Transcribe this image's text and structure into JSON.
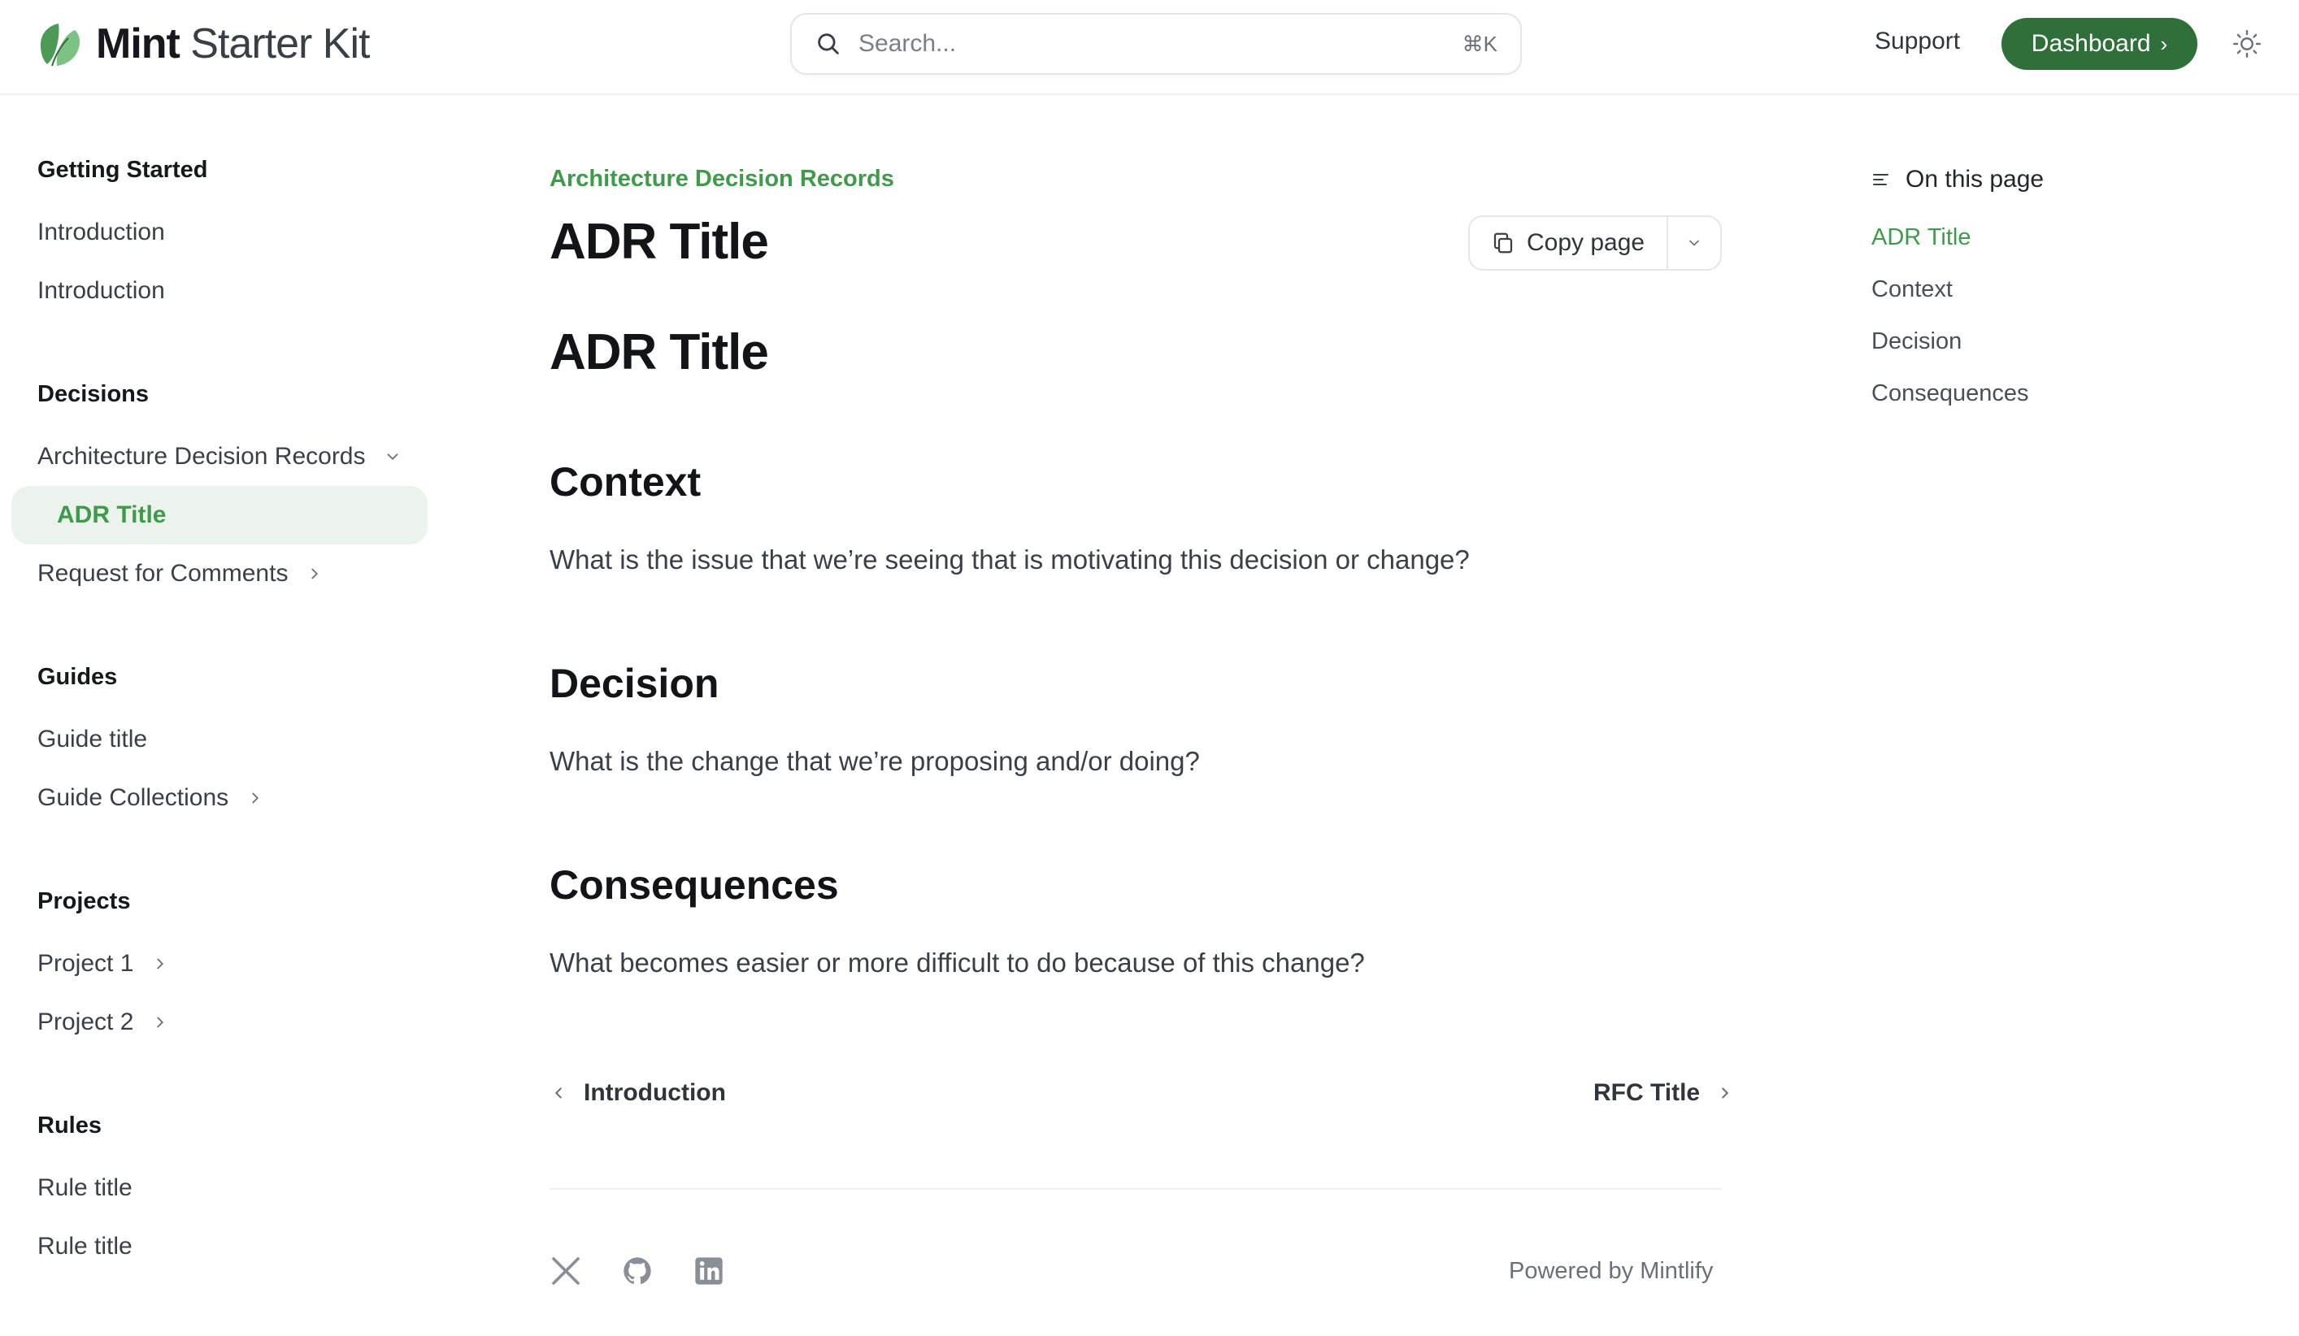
{
  "header": {
    "logo_bold": "Mint",
    "logo_light": "Starter Kit",
    "search_placeholder": "Search...",
    "search_shortcut": "⌘K",
    "support_label": "Support",
    "dashboard_label": "Dashboard",
    "accent_color": "#2f6f3a"
  },
  "sidebar": {
    "groups": [
      {
        "title": "Getting Started",
        "items": [
          {
            "label": "Introduction"
          },
          {
            "label": "Introduction"
          }
        ]
      },
      {
        "title": "Decisions",
        "items": [
          {
            "label": "Architecture Decision Records",
            "expanded": true
          },
          {
            "label": "ADR Title",
            "active": true
          },
          {
            "label": "Request for Comments"
          }
        ]
      },
      {
        "title": "Guides",
        "items": [
          {
            "label": "Guide title"
          },
          {
            "label": "Guide Collections"
          }
        ]
      },
      {
        "title": "Projects",
        "items": [
          {
            "label": "Project 1"
          },
          {
            "label": "Project 2"
          }
        ]
      },
      {
        "title": "Rules",
        "items": [
          {
            "label": "Rule title"
          },
          {
            "label": "Rule title"
          }
        ]
      }
    ]
  },
  "main": {
    "breadcrumb": "Architecture Decision Records",
    "title": "ADR Title",
    "copy_label": "Copy page",
    "content_h1": "ADR Title",
    "sections": [
      {
        "heading": "Context",
        "body": "What is the issue that we’re seeing that is motivating this decision or change?"
      },
      {
        "heading": "Decision",
        "body": "What is the change that we’re proposing and/or doing?"
      },
      {
        "heading": "Consequences",
        "body": "What becomes easier or more difficult to do because of this change?"
      }
    ],
    "prev_label": "Introduction",
    "next_label": "RFC Title",
    "footer": {
      "social_icons": [
        "x-icon",
        "github-icon",
        "linkedin-icon"
      ],
      "powered_by": "Powered by Mintlify"
    }
  },
  "toc": {
    "heading": "On this page",
    "items": [
      {
        "label": "ADR Title",
        "active": true
      },
      {
        "label": "Context"
      },
      {
        "label": "Decision"
      },
      {
        "label": "Consequences"
      }
    ],
    "active_color": "#3f9a4b"
  }
}
